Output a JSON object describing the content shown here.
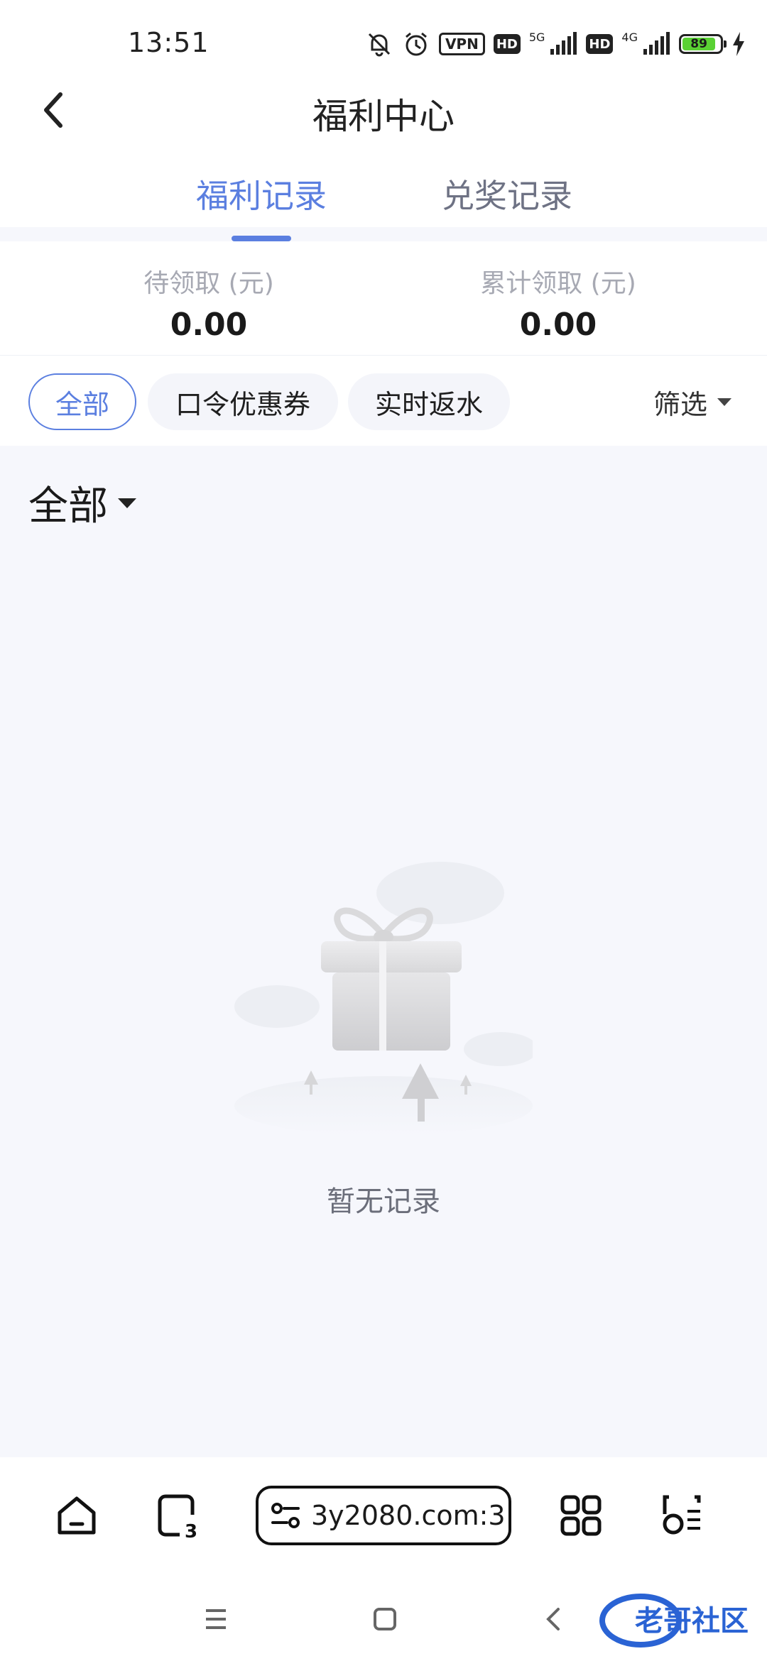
{
  "status_bar": {
    "time": "13:51",
    "vpn": "VPN",
    "hd1": "HD",
    "net1": "5G",
    "hd2": "HD",
    "net2": "4G",
    "battery": "89",
    "icons": [
      "mute-bell-icon",
      "alarm-icon",
      "signal-icon",
      "charging-icon"
    ]
  },
  "header": {
    "title": "福利中心",
    "back_icon": "chevron-left-icon"
  },
  "tabs": [
    {
      "label": "福利记录",
      "active": true
    },
    {
      "label": "兑奖记录",
      "active": false
    }
  ],
  "summary": {
    "pending_label": "待领取 (元)",
    "pending_value": "0.00",
    "total_label": "累计领取 (元)",
    "total_value": "0.00"
  },
  "filters": {
    "chips": [
      {
        "label": "全部",
        "active": true
      },
      {
        "label": "口令优惠券",
        "active": false
      },
      {
        "label": "实时返水",
        "active": false
      }
    ],
    "filter_label": "筛选"
  },
  "content": {
    "group_label": "全部",
    "empty_text": "暂无记录",
    "empty_icon": "gift-box-icon"
  },
  "browser_bar": {
    "url": "3y2080.com:3",
    "tab_count": "3",
    "icons": [
      "home-icon",
      "tabs-icon",
      "site-settings-icon",
      "apps-grid-icon",
      "scan-icon"
    ]
  },
  "nav_bar": {
    "icons": [
      "menu-icon",
      "home-square-icon",
      "back-icon"
    ],
    "watermark": "老哥社区"
  },
  "colors": {
    "accent": "#5b7fe0",
    "background": "#f6f7fc"
  }
}
